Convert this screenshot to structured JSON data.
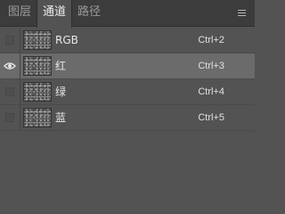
{
  "tabs": [
    {
      "label": "图层",
      "active": false
    },
    {
      "label": "通道",
      "active": true
    },
    {
      "label": "路径",
      "active": false
    }
  ],
  "menu_icon": "hamburger-menu-icon",
  "channels": [
    {
      "name": "RGB",
      "shortcut": "Ctrl+2",
      "visible": false,
      "selected": false
    },
    {
      "name": "红",
      "shortcut": "Ctrl+3",
      "visible": true,
      "selected": true
    },
    {
      "name": "绿",
      "shortcut": "Ctrl+4",
      "visible": false,
      "selected": false
    },
    {
      "name": "蓝",
      "shortcut": "Ctrl+5",
      "visible": false,
      "selected": false
    }
  ],
  "colors": {
    "panel_bg": "#535353",
    "tabbar_bg": "#3c3c3c",
    "selected_row": "#6b6b6b"
  }
}
